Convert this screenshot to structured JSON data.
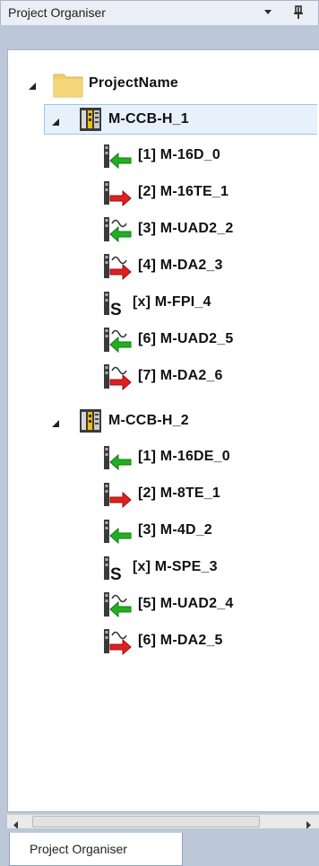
{
  "panel": {
    "title": "Project Organiser",
    "tab_label": "Project Organiser"
  },
  "tree": {
    "root": {
      "label": "ProjectName",
      "icon": "folder-icon"
    },
    "controllers": [
      {
        "label": "M-CCB-H_1",
        "icon": "controller-icon",
        "selected": true,
        "modules": [
          {
            "label": "[1] M-16D_0",
            "icon": "digital-input-icon"
          },
          {
            "label": "[2] M-16TE_1",
            "icon": "digital-output-icon"
          },
          {
            "label": "[3] M-UAD2_2",
            "icon": "analog-input-icon"
          },
          {
            "label": "[4] M-DA2_3",
            "icon": "analog-output-icon"
          },
          {
            "label": "[x] M-FPI_4",
            "icon": "special-module-icon"
          },
          {
            "label": "[6] M-UAD2_5",
            "icon": "analog-input-icon"
          },
          {
            "label": "[7] M-DA2_6",
            "icon": "analog-output-icon"
          }
        ]
      },
      {
        "label": "M-CCB-H_2",
        "icon": "controller-icon",
        "selected": false,
        "modules": [
          {
            "label": "[1] M-16DE_0",
            "icon": "digital-input-icon"
          },
          {
            "label": "[2] M-8TE_1",
            "icon": "digital-output-icon"
          },
          {
            "label": "[3] M-4D_2",
            "icon": "digital-input-icon"
          },
          {
            "label": "[x] M-SPE_3",
            "icon": "special-module-icon"
          },
          {
            "label": "[5] M-UAD2_4",
            "icon": "analog-input-icon"
          },
          {
            "label": "[6] M-DA2_5",
            "icon": "analog-output-icon"
          }
        ]
      }
    ]
  },
  "colors": {
    "selection_bg": "#e7f1fb",
    "selection_border": "#9fc5ea",
    "input_arrow": "#22b022",
    "output_arrow": "#e02020",
    "folder": "#f0cf6b"
  }
}
